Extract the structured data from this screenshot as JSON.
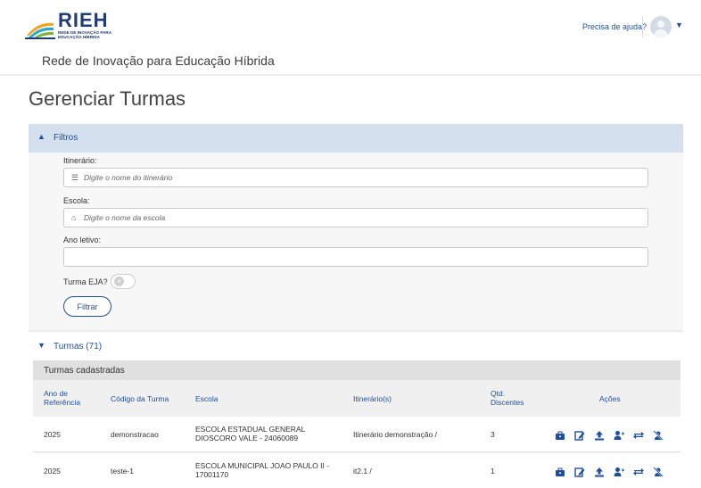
{
  "header": {
    "logo_text": "RIEH",
    "logo_subtitle": "REDE DE INOVAÇÃO PARA EDUCAÇÃO HÍBRIDA",
    "site_name": "Rede de Inovação para Educação Híbrida",
    "help_link": "Precisa de ajuda?"
  },
  "page": {
    "title": "Gerenciar Turmas"
  },
  "filters": {
    "section_label": "Filtros",
    "itinerario": {
      "label": "Itinerário:",
      "placeholder": "Digite o nome do itinerário"
    },
    "escola": {
      "label": "Escola:",
      "placeholder": "Digite o nome da escola"
    },
    "ano_letivo": {
      "label": "Ano letivo:",
      "placeholder": ""
    },
    "turma_eja": {
      "label": "Turma EJA?",
      "checked": false
    },
    "submit_label": "Filtrar"
  },
  "turmas": {
    "section_label": "Turmas (71)",
    "table_title": "Turmas cadastradas",
    "columns": [
      "Ano de Referência",
      "Código da Turma",
      "Escola",
      "Itinerário(s)",
      "Qtd. Discentes",
      "Ações"
    ],
    "rows": [
      {
        "ano": "2025",
        "codigo": "demonstracao",
        "escola": "ESCOLA ESTADUAL GENERAL DIOSCORO VALE - 24060089",
        "itinerario": "Itinerário demonstração /",
        "qtd": "3"
      },
      {
        "ano": "2025",
        "codigo": "teste-1",
        "escola": "ESCOLA MUNICIPAL JOAO PAULO II - 17001170",
        "itinerario": "it2.1 /",
        "qtd": "1"
      }
    ],
    "action_icons": [
      "briefcase-icon",
      "edit-icon",
      "upload-icon",
      "add-user-icon",
      "swap-icon",
      "remove-user-icon"
    ]
  },
  "colors": {
    "primary": "#1f4f9c",
    "filters_bar": "#d5e0ef",
    "logo_navy": "#1f3c73"
  }
}
